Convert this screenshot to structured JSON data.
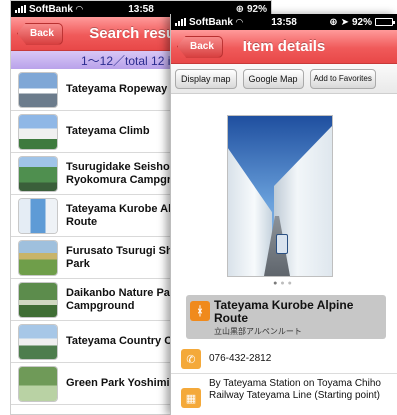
{
  "back_screen": {
    "status": {
      "carrier": "SoftBank",
      "time": "13:58",
      "battery": "92%",
      "battery_level": 0.92
    },
    "nav": {
      "back_label": "Back",
      "title": "Search results"
    },
    "count_text": "1〜12／total 12 ite",
    "results": [
      {
        "name": "Tateyama Ropeway"
      },
      {
        "name": "Tateyama Climb"
      },
      {
        "name": "Tsurugidake Seishon\nRyokomura Campgr"
      },
      {
        "name": "Tateyama Kurobe Al\nRoute"
      },
      {
        "name": "Furusato Tsurugi Sh\nPark"
      },
      {
        "name": "Daikanbo Nature Pa\nCampground"
      },
      {
        "name": "Tateyama Country C"
      },
      {
        "name": "Green Park Yoshimi"
      }
    ]
  },
  "front_screen": {
    "status": {
      "carrier": "SoftBank",
      "time": "13:58",
      "battery": "92%",
      "battery_level": 0.92
    },
    "nav": {
      "back_label": "Back",
      "title": "Item details"
    },
    "buttons": {
      "display_map": "Display map",
      "google_map": "Google Map",
      "add_favorites": "Add to Favorites"
    },
    "pager": {
      "total": 3,
      "current": 1
    },
    "item": {
      "title": "Tateyama Kurobe Alpine Route",
      "subtitle": "立山黒部アルペンルート",
      "phone": "076-432-2812",
      "access": "By Tateyama Station on Toyama Chiho Railway Tateyama Line (Starting point)"
    },
    "icons": {
      "title": "ropeway-icon",
      "phone": "phone-icon",
      "access": "train-icon",
      "accent": "#f08a1c"
    }
  }
}
